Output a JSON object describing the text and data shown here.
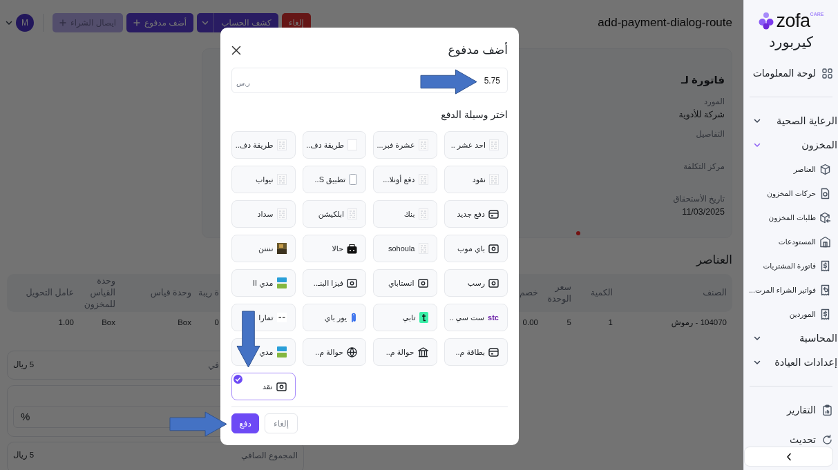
{
  "header": {
    "title": "add-payment-dialog-route",
    "actions": [
      {
        "label": "إلغاء",
        "kind": "danger",
        "disabled": false
      },
      {
        "label": "كشف الحساب",
        "kind": "split",
        "disabled": false
      },
      {
        "label": "أضف مدفوع",
        "kind": "add",
        "disabled": false
      },
      {
        "label": "ايصال الشراء",
        "kind": "add",
        "disabled": true
      }
    ],
    "user": {
      "initial": "M"
    }
  },
  "invoice": {
    "title": "فاتورة لـ",
    "fields": [
      {
        "label": "المورد",
        "value": "شركة للأدوية"
      },
      {
        "label": "التفاصيل"
      },
      {
        "label": "مركز التكلفة"
      },
      {
        "label": "تاريخ الأستحقاق",
        "value": "11/03/2025"
      }
    ]
  },
  "items": {
    "heading": "العناصر",
    "columns": [
      "الصنف",
      "الكمية",
      "سعر الوحدة",
      "خصم",
      "ة ريبة",
      "وحدة قياس",
      "وحدة القياس للمخزون",
      "عامل التحويل"
    ],
    "rows": [
      [
        "104070 - رموش",
        "1",
        "5",
        "0.00",
        "0",
        "Box",
        "Box",
        "1.00"
      ]
    ]
  },
  "summary": [
    {
      "kind": "total",
      "label": "في",
      "value": "5 ريال"
    },
    {
      "kind": "input",
      "suffix": "%"
    },
    {
      "kind": "total",
      "label": "المجموع الصافي",
      "value": "5 ريال"
    }
  ],
  "dialog": {
    "title": "أضف مدفوع",
    "amount": "5.75",
    "currency": "ر.س",
    "prompt": "اختر وسيلة الدفع",
    "methods": [
      {
        "label": "احد عشر ..",
        "kind": "thumb",
        "selected": false
      },
      {
        "label": "عشرة فبر...",
        "kind": "thumb",
        "selected": false
      },
      {
        "label": "طريقة دف..",
        "kind": "blank",
        "selected": false
      },
      {
        "label": "طريقة دف..",
        "kind": "thumb",
        "selected": false
      },
      {
        "label": "نقود",
        "kind": "thumb",
        "selected": false
      },
      {
        "label": "دفع أونلا...",
        "kind": "thumb",
        "selected": false
      },
      {
        "label": "تطبيق S..",
        "kind": "phone",
        "selected": false
      },
      {
        "label": "نيواب",
        "kind": "thumb",
        "selected": false
      },
      {
        "label": "دفع جديد",
        "kind": "card",
        "selected": false
      },
      {
        "label": "بنك",
        "kind": "thumb",
        "selected": false
      },
      {
        "label": "ابلكيشن",
        "kind": "thumb",
        "selected": false
      },
      {
        "label": "سداد",
        "kind": "thumb",
        "selected": false
      },
      {
        "label": "باي موب",
        "kind": "cash",
        "selected": false
      },
      {
        "label": "sohoula",
        "kind": "thumb",
        "selected": false
      },
      {
        "label": "حالا",
        "kind": "bag",
        "selected": false
      },
      {
        "label": "ننننن",
        "kind": "photo",
        "selected": false
      },
      {
        "label": "رسب",
        "kind": "cash",
        "selected": false
      },
      {
        "label": "انستاباي",
        "kind": "cash",
        "selected": false
      },
      {
        "label": "فيزا البنـ..",
        "kind": "cash",
        "selected": false
      },
      {
        "label": "مدي II",
        "kind": "bars",
        "selected": false
      },
      {
        "label": "ست سي ..",
        "kind": "logo",
        "logo_text": "stc",
        "selected": false
      },
      {
        "label": "تابي",
        "kind": "tile",
        "selected": false
      },
      {
        "label": "يور باي",
        "kind": "clip",
        "selected": false
      },
      {
        "label": "تمارا",
        "kind": "dashes",
        "selected": false
      },
      {
        "label": "بطاقة م..",
        "kind": "card",
        "selected": false
      },
      {
        "label": "حوالة م..",
        "kind": "bank",
        "selected": false
      },
      {
        "label": "حوالة م..",
        "kind": "globe",
        "selected": false
      },
      {
        "label": "مدي",
        "kind": "bars",
        "selected": false
      },
      {
        "label": "نقد",
        "kind": "cash",
        "selected": true
      }
    ],
    "buttons": [
      {
        "label": "إلغاء",
        "kind": "secondary"
      },
      {
        "label": "دفع",
        "kind": "primary"
      }
    ]
  },
  "sidebar": {
    "brand": "zofa",
    "brand_tag": "CARE",
    "clinic": "كيربورد",
    "items": [
      {
        "kind": "link",
        "label": "لوحة المعلومات"
      },
      {
        "kind": "divider"
      },
      {
        "kind": "group",
        "label": "الرعاية الصحية",
        "expanded": false
      },
      {
        "kind": "group",
        "label": "المخزون",
        "expanded": true,
        "children": [
          {
            "label": "العناصر"
          },
          {
            "label": "حركات المخزون"
          },
          {
            "label": "طلبات المخزون"
          },
          {
            "label": "المستودعات"
          },
          {
            "label": "فاتورة المشتريات"
          },
          {
            "label": "فواتير الشراء المرت..."
          },
          {
            "label": "الموردين"
          }
        ]
      },
      {
        "kind": "group",
        "label": "المحاسبة",
        "expanded": false
      },
      {
        "kind": "group",
        "label": "إعدادات العيادة",
        "expanded": false
      },
      {
        "kind": "divider"
      },
      {
        "kind": "link",
        "label": "التقارير"
      },
      {
        "kind": "link",
        "label": "تحديث"
      }
    ]
  }
}
